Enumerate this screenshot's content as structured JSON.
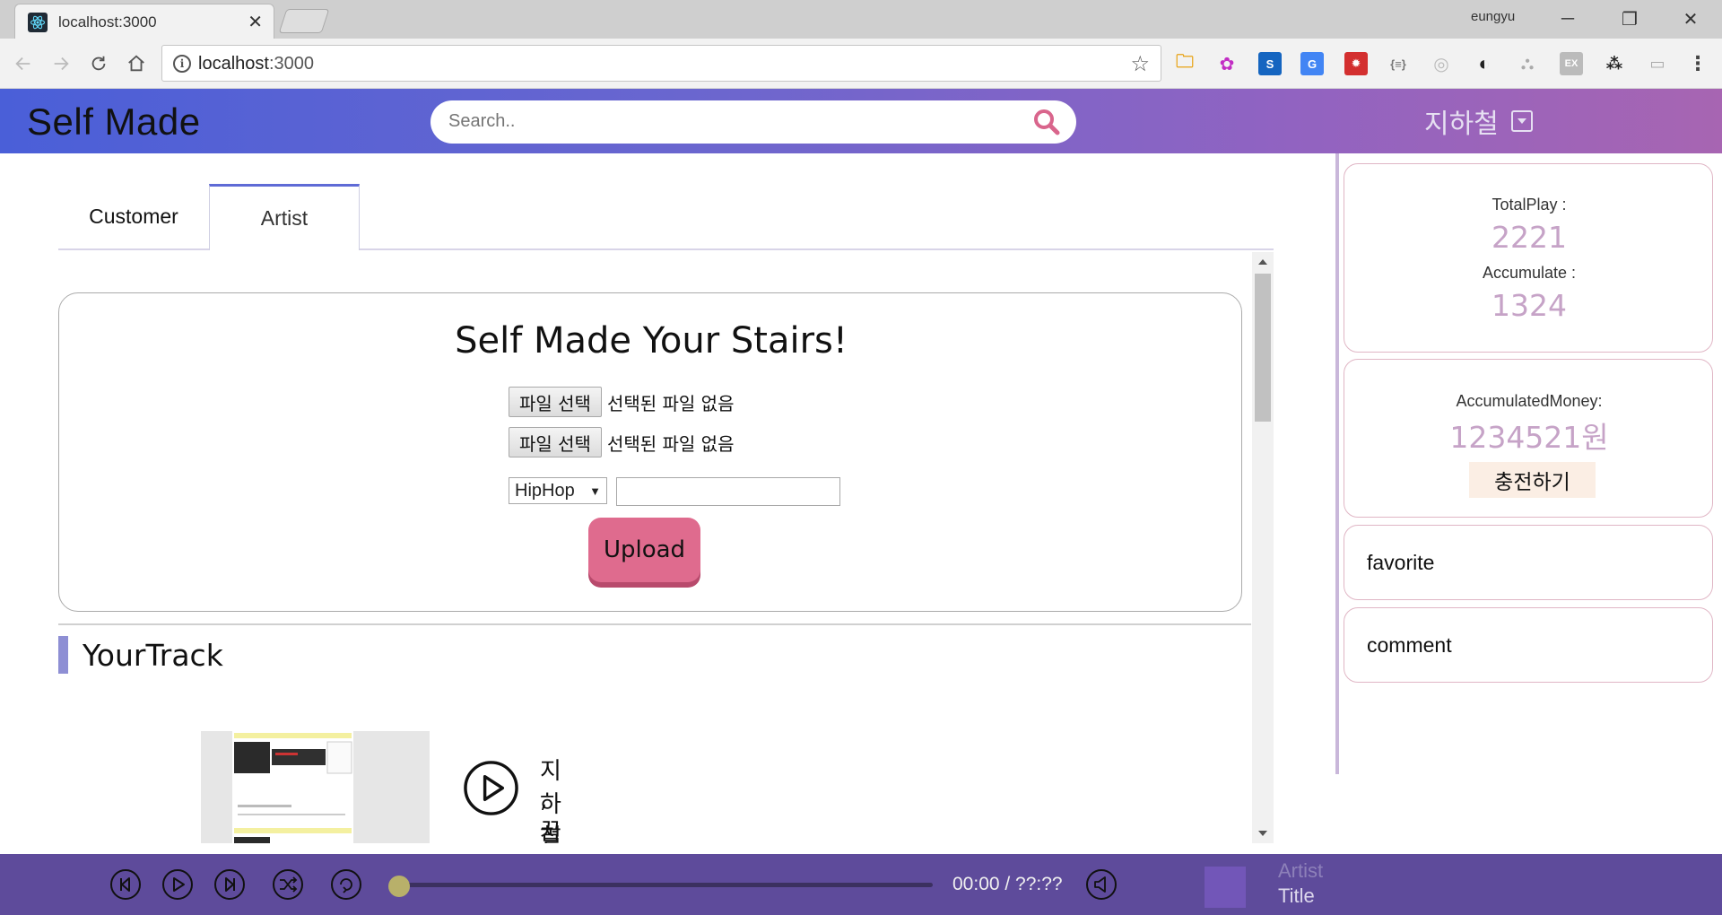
{
  "browser": {
    "tab_title": "localhost:3000",
    "url_host": "localhost",
    "url_port": ":3000",
    "window_user": "eungyu"
  },
  "header": {
    "brand": "Self Made",
    "search_placeholder": "Search..",
    "user_name": "지하철"
  },
  "tabs": [
    {
      "label": "Customer",
      "active": false
    },
    {
      "label": "Artist",
      "active": true
    }
  ],
  "upload": {
    "title": "Self Made Your Stairs!",
    "file_button": "파일 선택",
    "file_status": "선택된 파일 없음",
    "genre_selected": "HipHop",
    "title_value": "",
    "upload_label": "Upload"
  },
  "your_track": {
    "heading": "YourTrack",
    "tracks": [
      {
        "artist": "지하철",
        "title": ",꿈에"
      }
    ]
  },
  "stats": {
    "total_play_label": "TotalPlay :",
    "total_play": "2221",
    "accumulate_label": "Accumulate :",
    "accumulate": "1324",
    "money_label": "AccumulatedMoney:",
    "money": "1234521원",
    "charge_label": "충전하기"
  },
  "side_links": {
    "favorite": "favorite",
    "comment": "comment"
  },
  "player": {
    "time": "00:00 / ??:??",
    "artist": "Artist",
    "title": "Title",
    "progress": 0
  },
  "colors": {
    "header_gradient_start": "#4a5fd8",
    "header_gradient_end": "#a765b2",
    "accent_pink": "#df6b8e",
    "player_bg": "#5e4b9b",
    "stat_value": "#c6a3c7"
  }
}
